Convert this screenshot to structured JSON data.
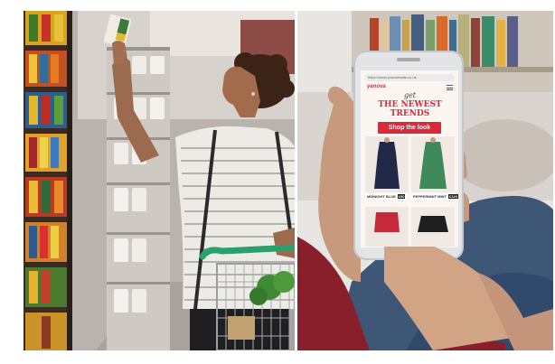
{
  "photos": {
    "left": {
      "subject": "woman-reaching-for-product-in-supermarket-aisle"
    },
    "right": {
      "subject": "hands-holding-smartphone-showing-fashion-site"
    }
  },
  "phone": {
    "url": "https://www.yourwebsite.co.uk",
    "brand": "yanova",
    "kicker": "get",
    "headline_line1": "THE NEWEST",
    "headline_line2": "TRENDS",
    "cta": "Shop the look",
    "products": [
      {
        "name": "MIDNIGHT BLUE",
        "price": "£90"
      },
      {
        "name": "PEPPERMINT MINT",
        "price": "£120"
      }
    ]
  },
  "colors": {
    "brand_red": "#d92a3b",
    "sweater": "#8a1f2c",
    "jeans": "#3e5777",
    "cart_handle": "#2aa06a"
  }
}
